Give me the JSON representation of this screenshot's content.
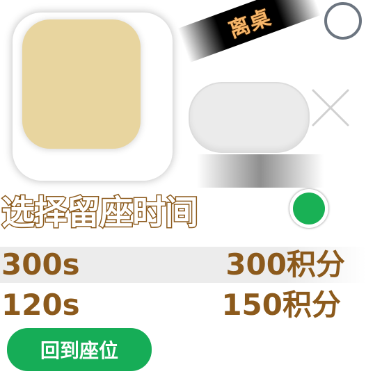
{
  "leave_tag": {
    "label": "离桌"
  },
  "title": {
    "text": "选择留座时间"
  },
  "options": [
    {
      "time": "300s",
      "points": "300积分"
    },
    {
      "time": "120s",
      "points": "150积分"
    }
  ],
  "return_button": {
    "label": "回到座位"
  },
  "icons": {
    "radio_unselected": "circle-outline-icon",
    "radio_selected": "circle-filled-icon",
    "close": "close-icon"
  },
  "colors": {
    "title_stroke": "#8c5a1c",
    "option_text": "#8c5a1c",
    "accent_green": "#16ad57",
    "avatar_fill": "#e8d59f",
    "leave_text": "#f7b66a"
  }
}
